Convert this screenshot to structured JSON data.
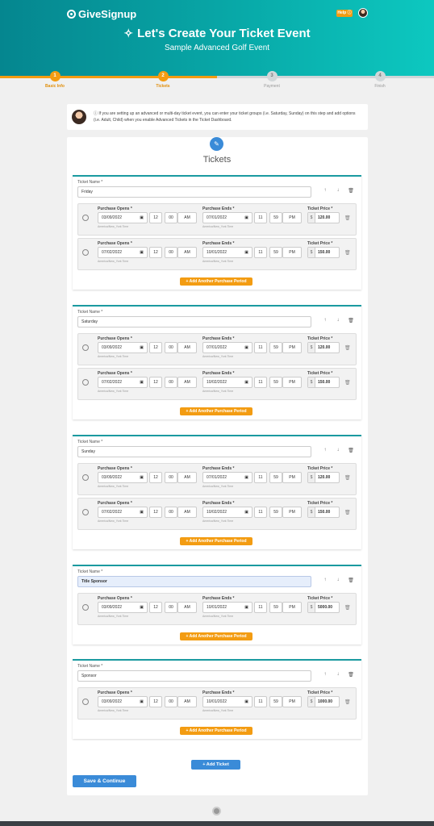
{
  "header": {
    "logo": "GiveSignup",
    "help_label": "Help ⓘ",
    "title": "Let's Create Your Ticket Event",
    "subtitle": "Sample Advanced Golf Event",
    "wand_icon": "✧"
  },
  "steps": [
    {
      "num": "1",
      "label": "Basic Info"
    },
    {
      "num": "2",
      "label": "Tickets"
    },
    {
      "num": "3",
      "label": "Payment"
    },
    {
      "num": "4",
      "label": "Finish"
    }
  ],
  "progress": {
    "fraction": 0.5
  },
  "info_text": "ⓘ If you are setting up an advanced or multi-day ticket event, you can enter your ticket groups (i.e. Saturday, Sunday) on this step and add options (i.e. Adult, Child) when you enable Advanced Tickets in the Ticket Dashboard.",
  "section_title": "Tickets",
  "labels": {
    "ticket_name": "Ticket Name *",
    "purchase_opens": "Purchase Opens *",
    "purchase_ends": "Purchase Ends *",
    "ticket_price": "Ticket Price *",
    "timezone": "America/New_York Time",
    "currency": "$",
    "add_period": "+ Add Another Purchase Period",
    "add_ticket": "+ Add Ticket",
    "save": "Save & Continue",
    "up_icon": "↑",
    "down_icon": "↓",
    "trash_icon": "🗑",
    "cal_icon": "▣",
    "colon": ":",
    "select_arrow": "∨"
  },
  "groups": [
    {
      "name": "Friday",
      "periods": [
        {
          "open_date": "03/09/2022",
          "open_h": "12",
          "open_m": "00",
          "open_ap": "AM",
          "end_date": "07/01/2022",
          "end_h": "11",
          "end_m": "59",
          "end_ap": "PM",
          "price": "120.00"
        },
        {
          "open_date": "07/02/2022",
          "open_h": "12",
          "open_m": "00",
          "open_ap": "AM",
          "end_date": "10/01/2022",
          "end_h": "11",
          "end_m": "59",
          "end_ap": "PM",
          "price": "150.00"
        }
      ]
    },
    {
      "name": "Saturday",
      "periods": [
        {
          "open_date": "03/09/2022",
          "open_h": "12",
          "open_m": "00",
          "open_ap": "AM",
          "end_date": "07/01/2022",
          "end_h": "11",
          "end_m": "59",
          "end_ap": "PM",
          "price": "120.00"
        },
        {
          "open_date": "07/02/2022",
          "open_h": "12",
          "open_m": "00",
          "open_ap": "AM",
          "end_date": "10/02/2022",
          "end_h": "11",
          "end_m": "59",
          "end_ap": "PM",
          "price": "150.00"
        }
      ]
    },
    {
      "name": "Sunday",
      "periods": [
        {
          "open_date": "03/09/2022",
          "open_h": "12",
          "open_m": "00",
          "open_ap": "AM",
          "end_date": "07/01/2022",
          "end_h": "11",
          "end_m": "59",
          "end_ap": "PM",
          "price": "120.00"
        },
        {
          "open_date": "07/02/2022",
          "open_h": "12",
          "open_m": "00",
          "open_ap": "AM",
          "end_date": "10/02/2022",
          "end_h": "11",
          "end_m": "59",
          "end_ap": "PM",
          "price": "150.00"
        }
      ]
    },
    {
      "name": "Title Sponsor",
      "periods": [
        {
          "open_date": "03/09/2022",
          "open_h": "12",
          "open_m": "00",
          "open_ap": "AM",
          "end_date": "10/01/2022",
          "end_h": "11",
          "end_m": "59",
          "end_ap": "PM",
          "price": "5000.00"
        }
      ]
    },
    {
      "name": "Sponsor",
      "periods": [
        {
          "open_date": "03/09/2022",
          "open_h": "12",
          "open_m": "00",
          "open_ap": "AM",
          "end_date": "10/01/2022",
          "end_h": "11",
          "end_m": "59",
          "end_ap": "PM",
          "price": "1000.00"
        }
      ]
    }
  ]
}
